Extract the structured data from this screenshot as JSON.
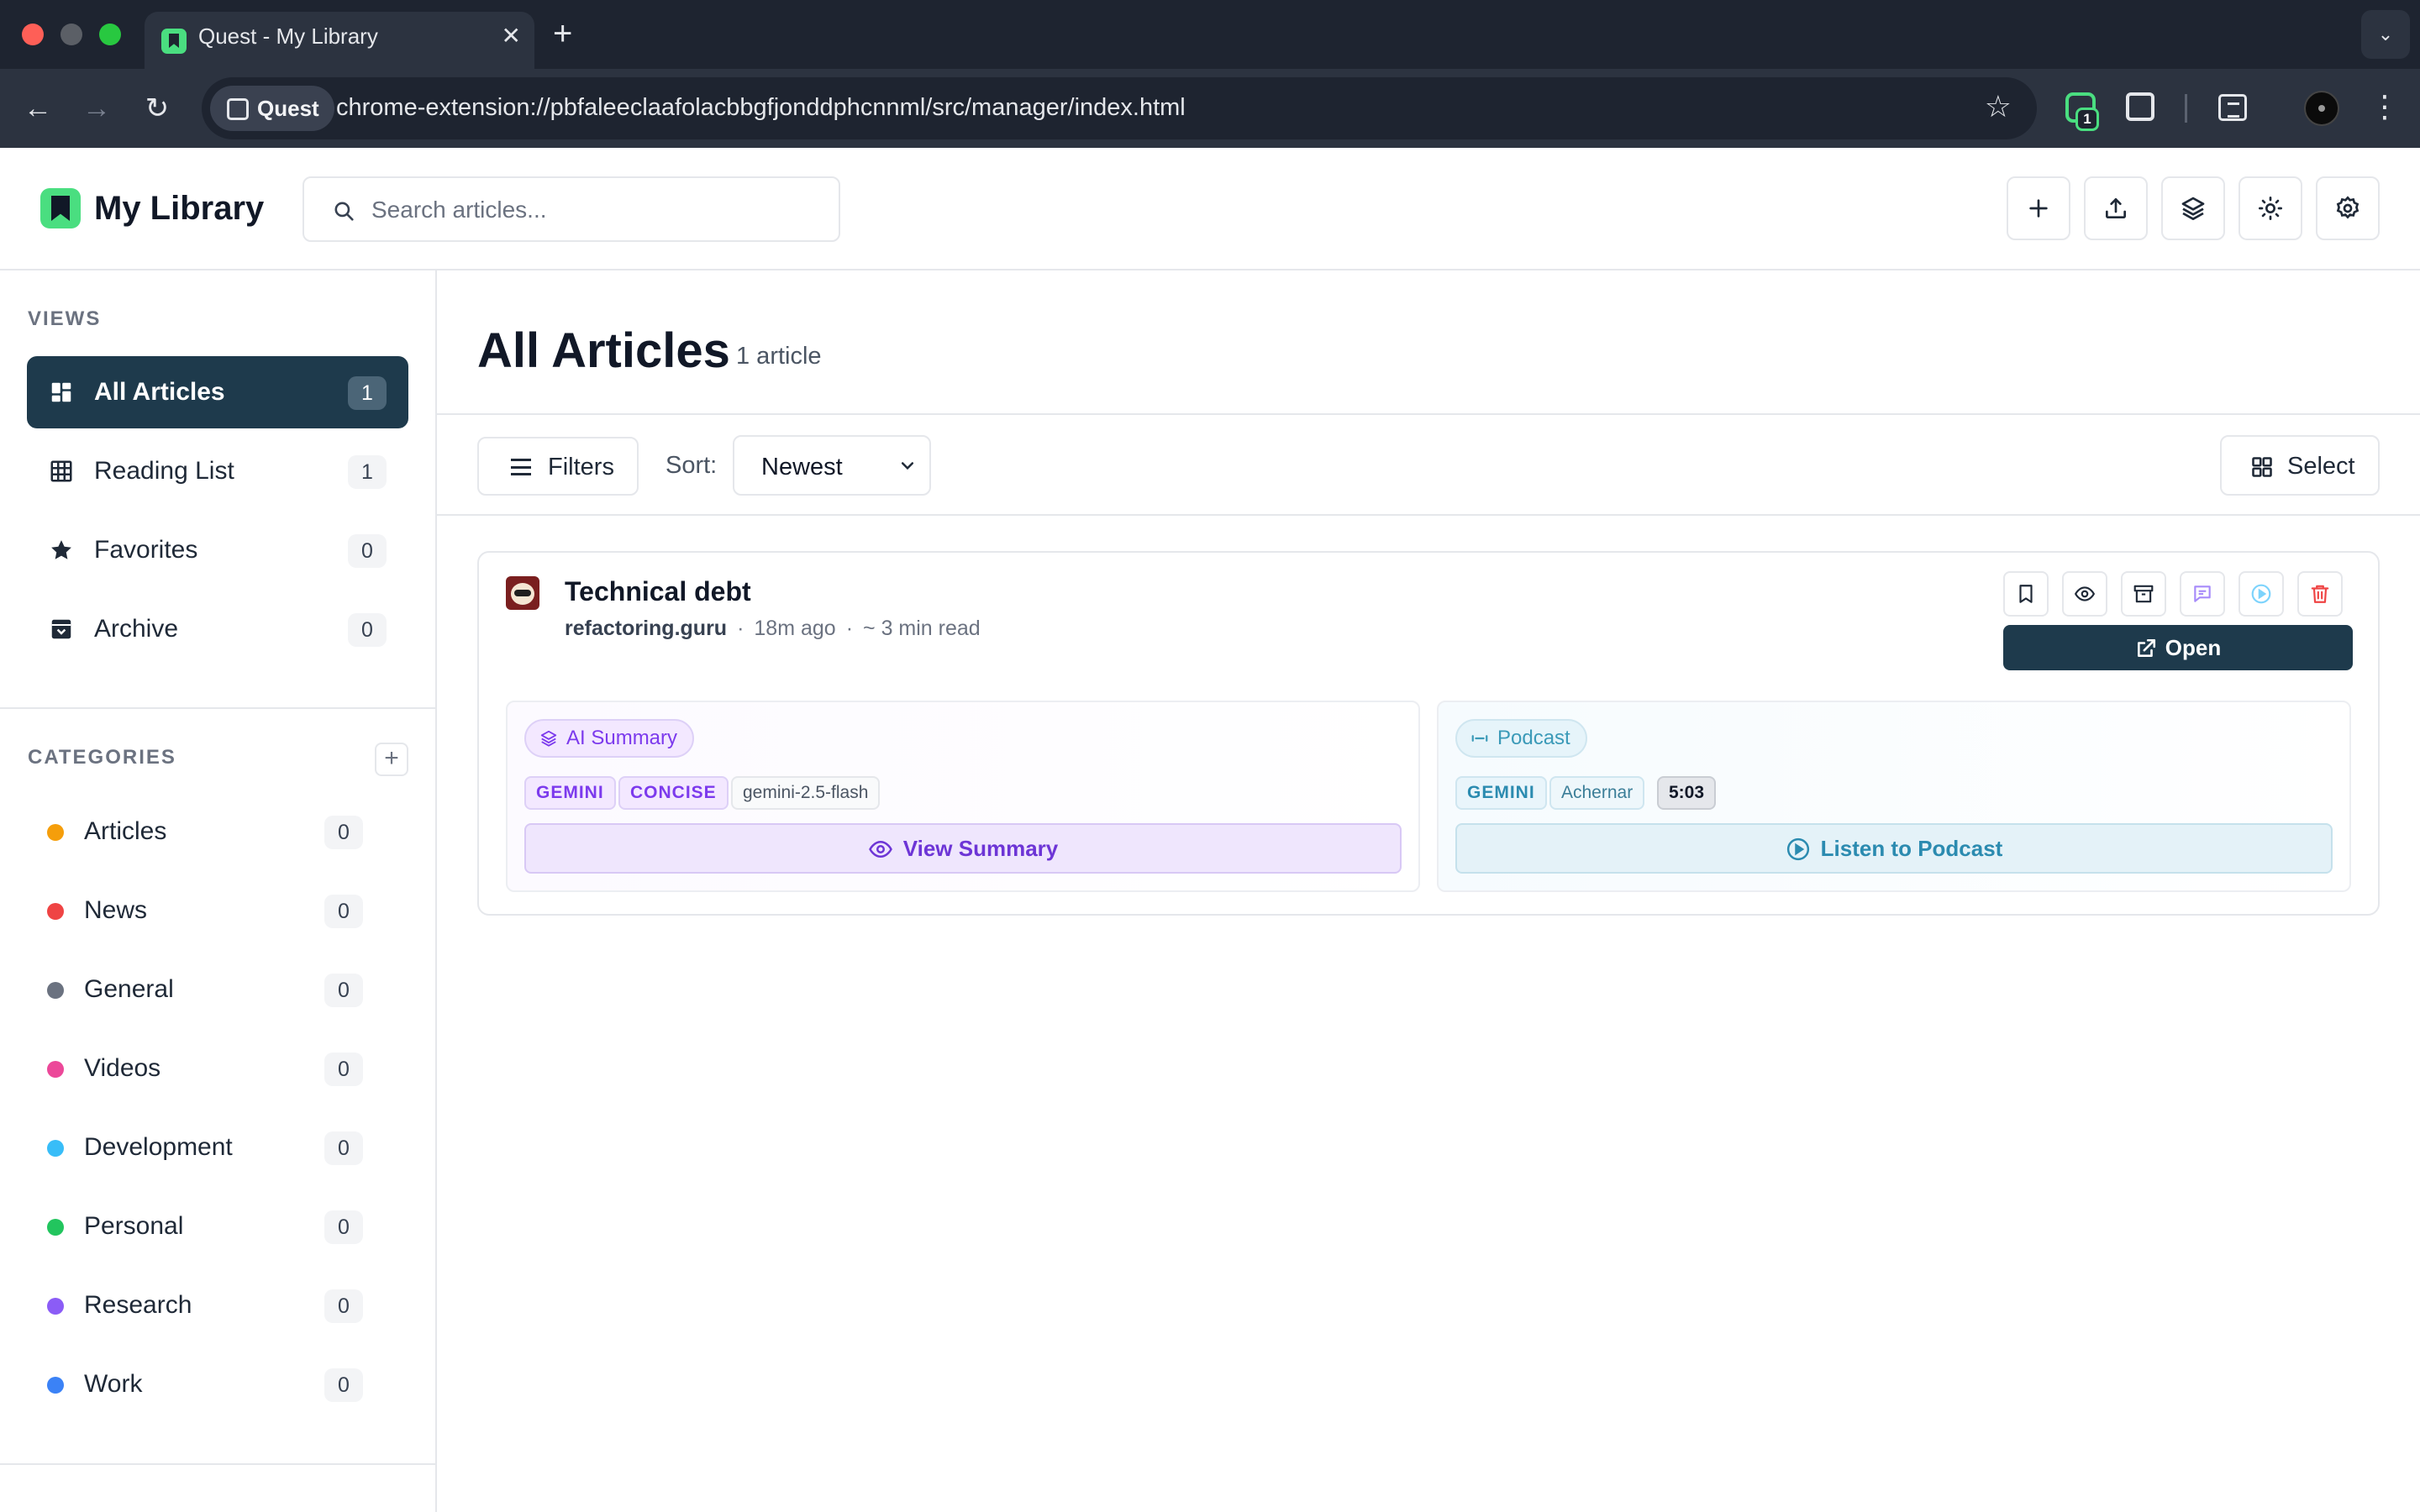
{
  "browser": {
    "tab_title": "Quest - My Library",
    "site_chip": "Quest",
    "url": "chrome-extension://pbfaleeclaafolacbbgfjonddphcnnml/src/manager/index.html",
    "extension_badge": "1"
  },
  "header": {
    "title": "My Library",
    "search_placeholder": "Search articles...",
    "buttons": [
      "add-icon",
      "upload-icon",
      "layers-icon",
      "sun-icon",
      "gear-icon"
    ]
  },
  "sidebar": {
    "views_label": "VIEWS",
    "views": [
      {
        "label": "All Articles",
        "count": "1",
        "icon": "grid-icon",
        "active": true
      },
      {
        "label": "Reading List",
        "count": "1",
        "icon": "table-icon"
      },
      {
        "label": "Favorites",
        "count": "0",
        "icon": "star-icon"
      },
      {
        "label": "Archive",
        "count": "0",
        "icon": "archive-icon"
      }
    ],
    "categories_label": "CATEGORIES",
    "categories": [
      {
        "label": "Articles",
        "count": "0",
        "color": "#f59e0b"
      },
      {
        "label": "News",
        "count": "0",
        "color": "#ef4444"
      },
      {
        "label": "General",
        "count": "0",
        "color": "#6b7280"
      },
      {
        "label": "Videos",
        "count": "0",
        "color": "#ec4899"
      },
      {
        "label": "Development",
        "count": "0",
        "color": "#38bdf8"
      },
      {
        "label": "Personal",
        "count": "0",
        "color": "#22c55e"
      },
      {
        "label": "Research",
        "count": "0",
        "color": "#8b5cf6"
      },
      {
        "label": "Work",
        "count": "0",
        "color": "#3b82f6"
      }
    ]
  },
  "main": {
    "title": "All Articles",
    "count": "1 article",
    "filters_label": "Filters",
    "sort_label": "Sort:",
    "sort_value": "Newest",
    "select_label": "Select"
  },
  "article": {
    "title": "Technical debt",
    "domain": "refactoring.guru",
    "time_ago": "18m ago",
    "read_time": "~ 3 min read",
    "open_label": "Open",
    "summary": {
      "pill": "AI Summary",
      "tags": [
        "GEMINI",
        "CONCISE",
        "gemini-2.5-flash"
      ],
      "action": "View Summary"
    },
    "podcast": {
      "pill": "Podcast",
      "tags": [
        "GEMINI",
        "Achernar",
        "5:03"
      ],
      "action": "Listen to Podcast"
    }
  },
  "colors": {
    "accent": "#1e3a4c",
    "brand": "#4ade80",
    "summary": "#7c3aed",
    "podcast": "#2b8bb0",
    "danger": "#ef4444"
  }
}
